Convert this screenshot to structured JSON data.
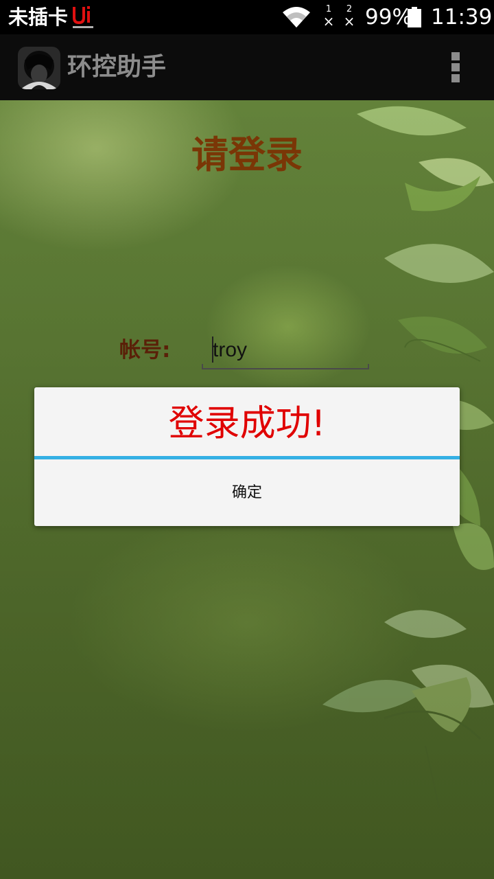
{
  "status_bar": {
    "carrier": "未插卡",
    "sim1_label": "1",
    "sim2_label": "2",
    "sim1_state": "×",
    "sim2_state": "×",
    "battery_percent": "99%",
    "time": "11:39",
    "icons": [
      "ui-emotion-logo-icon",
      "wifi-icon",
      "sim-signal-icon",
      "battery-icon"
    ]
  },
  "action_bar": {
    "title": "环控助手",
    "icons": [
      "app-avatar-icon",
      "overflow-menu-icon"
    ]
  },
  "login": {
    "title": "请登录",
    "account_label": "帐号:",
    "account_value": "troy"
  },
  "dialog": {
    "message": "登录成功!",
    "confirm_label": "确定"
  },
  "colors": {
    "status_bar_bg": "#000000",
    "action_bar_bg": "#0c0c0c",
    "title_text": "#7a3606",
    "dialog_message": "#e00000",
    "dialog_divider": "#35b0e4",
    "dialog_bg": "#f4f4f4"
  }
}
